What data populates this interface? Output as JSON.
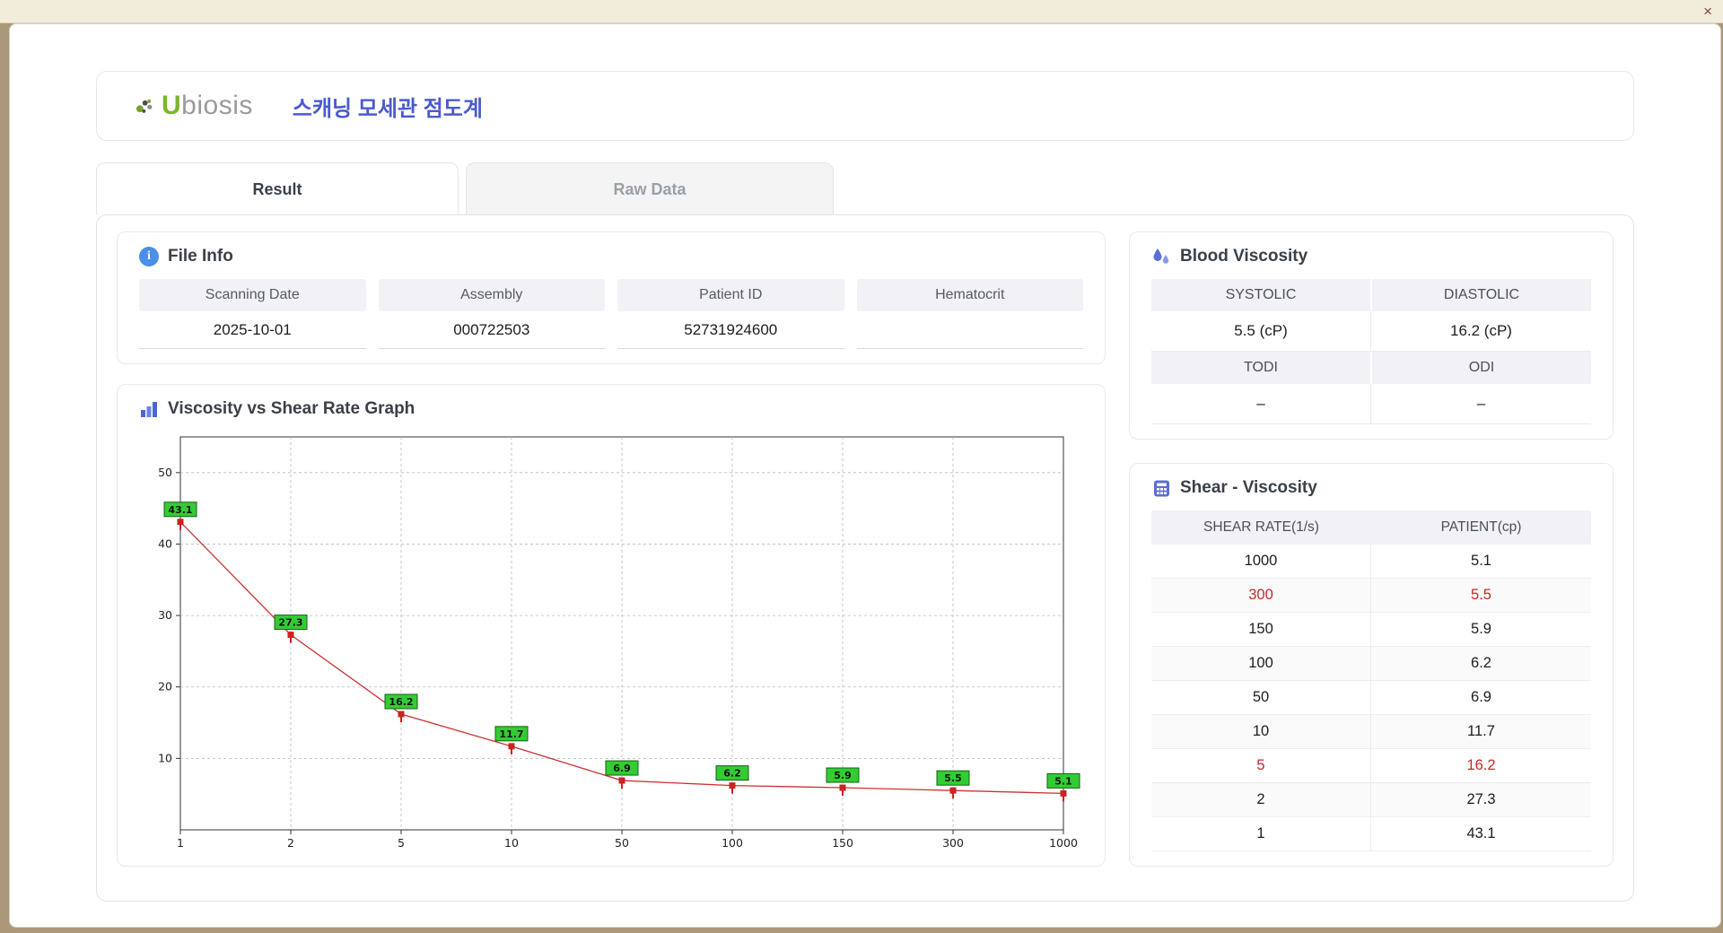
{
  "window": {
    "close_label": "×"
  },
  "header": {
    "logo_u": "U",
    "logo_rest": "biosis",
    "title": "스캐닝 모세관 점도계"
  },
  "tabs": [
    {
      "label": "Result",
      "active": true
    },
    {
      "label": "Raw Data",
      "active": false
    }
  ],
  "file_info": {
    "title": "File Info",
    "fields": [
      {
        "label": "Scanning Date",
        "value": "2025-10-01"
      },
      {
        "label": "Assembly",
        "value": "000722503"
      },
      {
        "label": "Patient ID",
        "value": "52731924600"
      },
      {
        "label": "Hematocrit",
        "value": ""
      }
    ]
  },
  "blood_viscosity": {
    "title": "Blood Viscosity",
    "rows": [
      {
        "headers": [
          "SYSTOLIC",
          "DIASTOLIC"
        ],
        "values": [
          "5.5 (cP)",
          "16.2 (cP)"
        ]
      },
      {
        "headers": [
          "TODI",
          "ODI"
        ],
        "values": [
          "–",
          "–"
        ]
      }
    ]
  },
  "shear_viscosity": {
    "title": "Shear - Viscosity",
    "columns": [
      "SHEAR RATE(1/s)",
      "PATIENT(cp)"
    ],
    "rows": [
      {
        "shear": "1000",
        "patient": "5.1",
        "highlight": false
      },
      {
        "shear": "300",
        "patient": "5.5",
        "highlight": true
      },
      {
        "shear": "150",
        "patient": "5.9",
        "highlight": false
      },
      {
        "shear": "100",
        "patient": "6.2",
        "highlight": false
      },
      {
        "shear": "50",
        "patient": "6.9",
        "highlight": false
      },
      {
        "shear": "10",
        "patient": "11.7",
        "highlight": false
      },
      {
        "shear": "5",
        "patient": "16.2",
        "highlight": true
      },
      {
        "shear": "2",
        "patient": "27.3",
        "highlight": false
      },
      {
        "shear": "1",
        "patient": "43.1",
        "highlight": false
      }
    ]
  },
  "graph": {
    "title": "Viscosity vs Shear Rate Graph"
  },
  "chart_data": {
    "type": "line",
    "title": "Viscosity vs Shear Rate Graph",
    "xlabel": "",
    "ylabel": "",
    "x_categories": [
      "1",
      "2",
      "5",
      "10",
      "50",
      "100",
      "150",
      "300",
      "1000"
    ],
    "values": [
      43.1,
      27.3,
      16.2,
      11.7,
      6.9,
      6.2,
      5.9,
      5.5,
      5.1
    ],
    "point_labels": [
      "43.1",
      "27.3",
      "16.2",
      "11.7",
      "6.9",
      "6.2",
      "5.9",
      "5.5",
      "5.1"
    ],
    "y_ticks": [
      10,
      20,
      30,
      40,
      50
    ],
    "ylim": [
      0,
      55
    ],
    "grid": "dashed",
    "legend": "none",
    "line_color": "#cc3333",
    "marker_color": "#cc2222",
    "label_bg": "#33cc33",
    "label_border": "#156015"
  },
  "colors": {
    "accent_blue": "#4a5ad0",
    "highlight_red": "#c62828",
    "icon_blue": "#5b6ed6"
  }
}
